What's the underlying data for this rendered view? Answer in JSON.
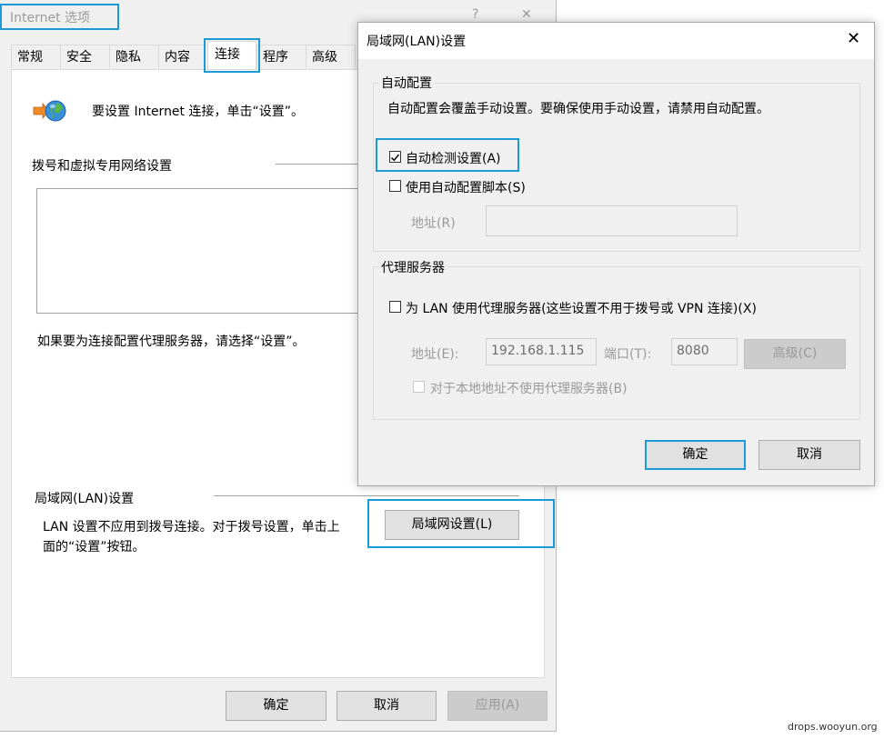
{
  "main_window": {
    "title": "Internet 选项",
    "help": "?",
    "close": "✕",
    "tabs": [
      "常规",
      "安全",
      "隐私",
      "内容",
      "连接",
      "程序",
      "高级"
    ],
    "active_tab": "连接",
    "setup_text": "要设置 Internet 连接，单击“设置”。",
    "dialup_section": "拨号和虚拟专用网络设置",
    "proxy_hint": "如果要为连接配置代理服务器，请选择“设置”。",
    "lan_section": "局域网(LAN)设置",
    "lan_desc_line1": "LAN 设置不应用到拨号连接。对于拨号设置，单击上",
    "lan_desc_line2": "面的“设置”按钮。",
    "lan_button": "局域网设置(L)",
    "ok": "确定",
    "cancel": "取消",
    "apply": "应用(A)"
  },
  "lan_dialog": {
    "title": "局域网(LAN)设置",
    "close": "✕",
    "auto_config": {
      "legend": "自动配置",
      "desc": "自动配置会覆盖手动设置。要确保使用手动设置，请禁用自动配置。",
      "auto_detect_label": "自动检测设置(A)",
      "auto_detect_checked": true,
      "script_label": "使用自动配置脚本(S)",
      "script_checked": false,
      "address_label": "地址(R)",
      "address_value": ""
    },
    "proxy": {
      "legend": "代理服务器",
      "use_proxy_label": "为 LAN 使用代理服务器(这些设置不用于拨号或 VPN 连接)(X)",
      "use_proxy_checked": false,
      "address_label": "地址(E):",
      "address_value": "192.168.1.115",
      "port_label": "端口(T):",
      "port_value": "8080",
      "advanced": "高级(C)",
      "bypass_label": "对于本地地址不使用代理服务器(B)",
      "bypass_checked": false
    },
    "ok": "确定",
    "cancel": "取消"
  },
  "watermark": "drops.wooyun.org",
  "colors": {
    "highlight": "#1c9ad6",
    "dialog_bg": "#f0f0f0"
  }
}
